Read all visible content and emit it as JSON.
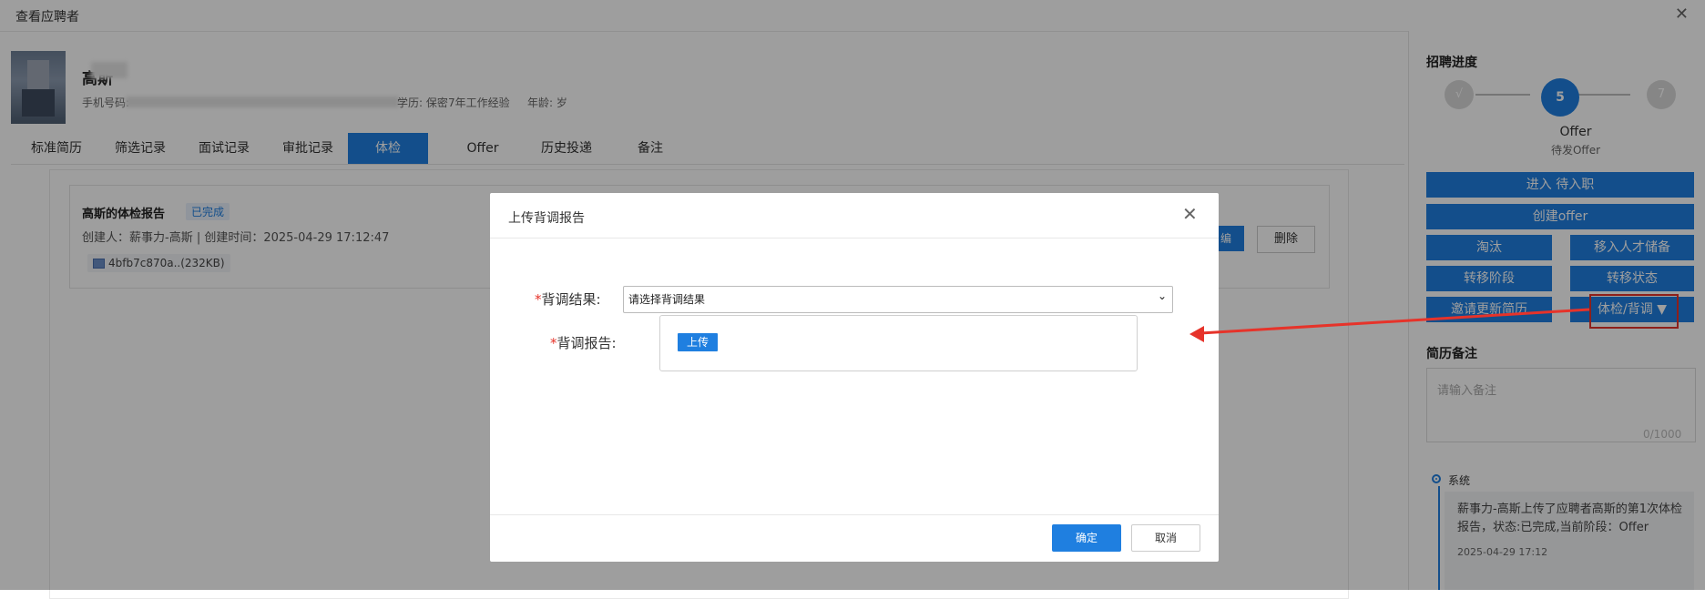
{
  "window": {
    "title": "查看应聘者",
    "close_icon": "close-icon"
  },
  "candidate": {
    "name": "高斯",
    "phone_label": "手机号码:",
    "meta_edu": "学历: 保密",
    "meta_exp": "7年工作经验",
    "meta_age": "年龄: 岁"
  },
  "tabs": [
    {
      "label": "标准简历"
    },
    {
      "label": "筛选记录"
    },
    {
      "label": "面试记录"
    },
    {
      "label": "审批记录"
    },
    {
      "label": "体检",
      "active": true
    },
    {
      "label": "Offer"
    },
    {
      "label": "历史投递"
    },
    {
      "label": "备注"
    }
  ],
  "report": {
    "title": "高斯的体检报告",
    "status": "已完成",
    "meta": "创建人：薪事力-高斯 | 创建时间：2025-04-29 17:12:47",
    "file": "4bfb7c870a..(232KB)",
    "edit_label": "编",
    "delete_label": "删除"
  },
  "progress": {
    "title": "招聘进度",
    "steps": [
      {
        "label": "√"
      },
      {
        "label": "5",
        "active": true
      },
      {
        "label": "7"
      }
    ],
    "current_stage": "Offer",
    "current_sub": "待发Offer",
    "buttons": {
      "enter_onboarding": "进入 待入职",
      "create_offer": "创建offer",
      "eliminate": "淘汰",
      "move_talent_pool": "移入人才储备",
      "transfer_stage": "转移阶段",
      "transfer_status": "转移状态",
      "invite_update_resume": "邀请更新简历",
      "physical_background": "体检/背调 ▼"
    }
  },
  "resume_notes": {
    "title": "简历备注",
    "placeholder": "请输入备注",
    "counter": "0/1000"
  },
  "timeline": {
    "source": "系统",
    "text": "薪事力-高斯上传了应聘者高斯的第1次体检报告，状态:已完成,当前阶段：Offer",
    "time": "2025-04-29 17:12"
  },
  "modal": {
    "title": "上传背调报告",
    "result_label": "背调结果:",
    "result_placeholder": "请选择背调结果",
    "report_label": "背调报告:",
    "upload_label": "上传",
    "ok_label": "确定",
    "cancel_label": "取消",
    "required_mark": "*"
  },
  "colors": {
    "accent": "#1f7fe0",
    "annotation": "#e6332a",
    "overlay": "rgba(0,0,0,0.38)"
  }
}
